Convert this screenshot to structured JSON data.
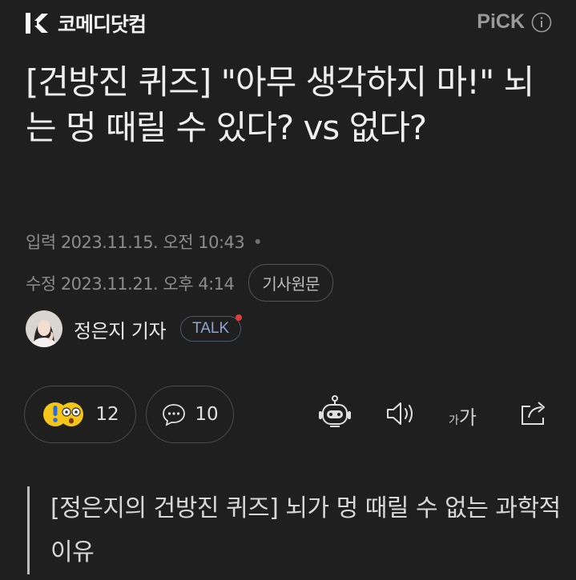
{
  "brand": {
    "name": "코메디닷컴",
    "logo_icon": "kormedi-logo-icon"
  },
  "pick": {
    "label": "PiCK",
    "info_icon": "info-icon"
  },
  "article": {
    "title": "[건방진 퀴즈] \"아무 생각하지 마!\" 뇌는 멍 때릴 수 있다? vs 없다?",
    "published": "입력 2023.11.15. 오전 10:43",
    "published_dot": "•",
    "modified": "수정 2023.11.21. 오후 4:14",
    "original_button": "기사원문"
  },
  "author": {
    "name": "정은지 기자",
    "talk_label": "TALK"
  },
  "actions": {
    "reaction_count": "12",
    "comment_count": "10",
    "font_size_label_small": "가",
    "font_size_label_large": "가"
  },
  "body": {
    "quote": "[정은지의 건방진 퀴즈] 뇌가 멍 때릴 수 없는 과학적 이유"
  },
  "colors": {
    "background": "#1f1f1f",
    "text": "#efefef",
    "muted": "#8c8c8c",
    "talk": "#8fa4d6",
    "talk_dot": "#e03b3b"
  }
}
